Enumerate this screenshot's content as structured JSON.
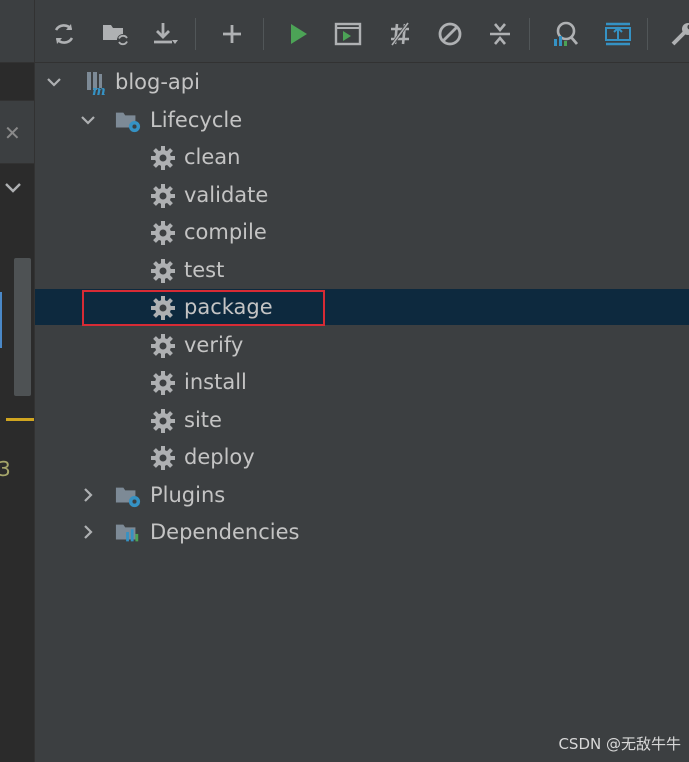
{
  "toolbar": {
    "buttons": [
      {
        "icon": "reload-icon"
      },
      {
        "icon": "generate-sources-icon"
      },
      {
        "icon": "download-icon"
      },
      {
        "icon": "add-icon"
      },
      {
        "icon": "run-icon"
      },
      {
        "icon": "execute-goal-icon"
      },
      {
        "icon": "toggle-offline-icon"
      },
      {
        "icon": "skip-tests-icon"
      },
      {
        "icon": "collapse-all-icon"
      },
      {
        "icon": "show-dependencies-icon"
      },
      {
        "icon": "expand-icon"
      },
      {
        "icon": "settings-wrench-icon"
      }
    ]
  },
  "tree": {
    "root": {
      "label": "blog-api",
      "expanded": true
    },
    "lifecycle": {
      "label": "Lifecycle",
      "expanded": true,
      "goals": [
        "clean",
        "validate",
        "compile",
        "test",
        "package",
        "verify",
        "install",
        "site",
        "deploy"
      ],
      "selected": "package"
    },
    "plugins": {
      "label": "Plugins",
      "expanded": false
    },
    "dependencies": {
      "label": "Dependencies",
      "expanded": false
    }
  },
  "editor_gutter": {
    "line_number": "3"
  },
  "colors": {
    "background": "#3c3f41",
    "selection": "#0d293e",
    "highlight_border": "#d62b35",
    "run_green": "#4ca356",
    "icon_blue": "#3592c4"
  },
  "watermark": "CSDN @无敌牛牛"
}
